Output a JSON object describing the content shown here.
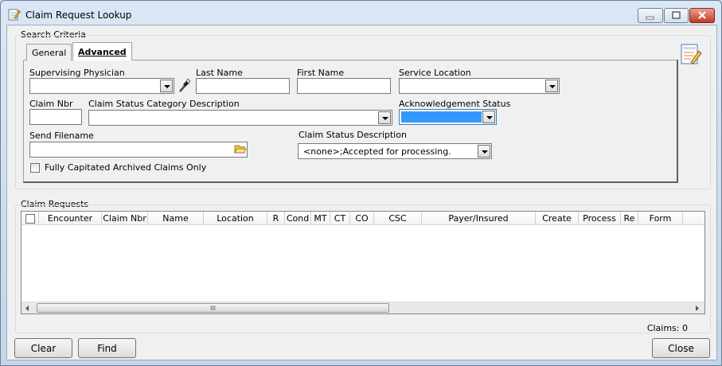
{
  "window": {
    "title": "Claim Request Lookup"
  },
  "search_criteria": {
    "group_title": "Search Criteria",
    "tabs": [
      {
        "label": "General"
      },
      {
        "label": "Advanced"
      }
    ],
    "fields": {
      "supervising_physician": {
        "label": "Supervising Physician",
        "value": ""
      },
      "last_name": {
        "label": "Last Name",
        "value": ""
      },
      "first_name": {
        "label": "First Name",
        "value": ""
      },
      "service_location": {
        "label": "Service Location",
        "value": ""
      },
      "claim_nbr": {
        "label": "Claim Nbr",
        "value": ""
      },
      "claim_status_category": {
        "label": "Claim Status Category Description",
        "value": ""
      },
      "ack_status": {
        "label": "Acknowledgement Status",
        "value": ""
      },
      "send_filename": {
        "label": "Send Filename",
        "value": ""
      },
      "claim_status_desc": {
        "label": "Claim Status Description",
        "value": "<none>;Accepted for processing."
      },
      "archived_checkbox": {
        "label": "Fully Capitated Archived Claims Only",
        "checked": false
      }
    }
  },
  "claim_requests": {
    "group_title": "Claim Requests",
    "columns": [
      "Encounter",
      "Claim Nbr",
      "Name",
      "Location",
      "R",
      "Cond",
      "MT",
      "CT",
      "CO",
      "CSC",
      "Payer/Insured",
      "Create",
      "Process",
      "Re",
      "Form"
    ],
    "rows": [],
    "scroll_grip": "III",
    "count_text": "Claims: 0"
  },
  "buttons": {
    "clear": "Clear",
    "find": "Find",
    "close": "Close"
  },
  "colors": {
    "selection": "#3399ff",
    "close_button": "#c33a25"
  }
}
